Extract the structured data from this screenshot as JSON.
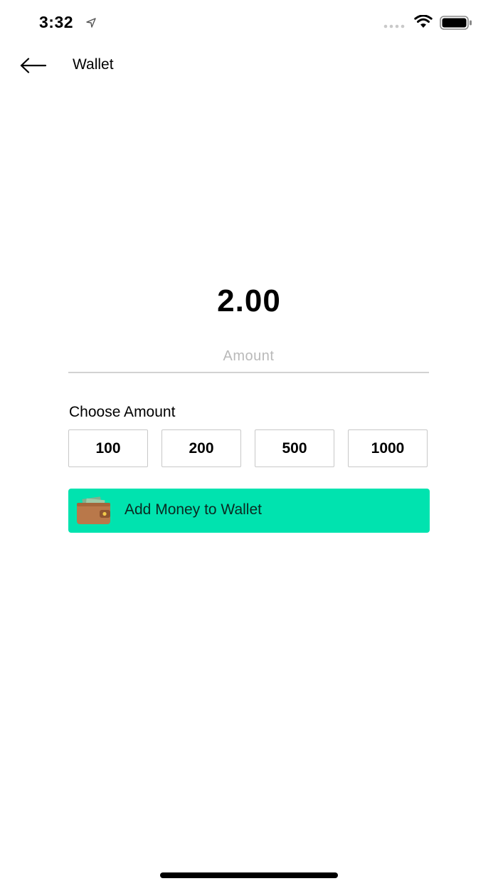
{
  "status_bar": {
    "time": "3:32",
    "location_icon": "location-arrow-icon",
    "signal_icon": "cellular-signal-icon",
    "wifi_icon": "wifi-icon",
    "battery_icon": "battery-icon"
  },
  "header": {
    "back_icon": "arrow-left-icon",
    "title": "Wallet"
  },
  "wallet": {
    "balance": "2.00",
    "amount_placeholder": "Amount",
    "amount_value": "",
    "choose_label": "Choose Amount",
    "preset_amounts": [
      "100",
      "200",
      "500",
      "1000"
    ],
    "add_button_label": "Add Money to Wallet",
    "add_button_icon": "wallet-icon"
  },
  "colors": {
    "accent": "#00e3af",
    "text": "#000000",
    "placeholder": "#b9b9b9",
    "border": "#c8c8c8"
  }
}
